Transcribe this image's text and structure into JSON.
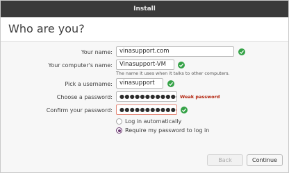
{
  "window": {
    "title": "Install"
  },
  "page": {
    "heading": "Who are you?"
  },
  "form": {
    "name": {
      "label": "Your name:",
      "value": "vinasupport.com"
    },
    "computer": {
      "label": "Your computer's name:",
      "value": "Vinasupport-VM",
      "hint": "The name it uses when it talks to other computers."
    },
    "username": {
      "label": "Pick a username:",
      "value": "vinasupport"
    },
    "password": {
      "label": "Choose a password:",
      "value": "●●●●●●●●●●●●",
      "strength": "Weak password"
    },
    "confirm": {
      "label": "Confirm your password:",
      "value": "●●●●●●●●●●●●"
    },
    "login_options": [
      {
        "label": "Log in automatically",
        "selected": false
      },
      {
        "label": "Require my password to log in",
        "selected": true
      }
    ]
  },
  "buttons": {
    "back": "Back",
    "continue": "Continue"
  },
  "colors": {
    "titlebar": "#3a3a3a",
    "valid": "#35a247",
    "weak": "#b1210a",
    "radio_selected": "#6e3c74"
  }
}
